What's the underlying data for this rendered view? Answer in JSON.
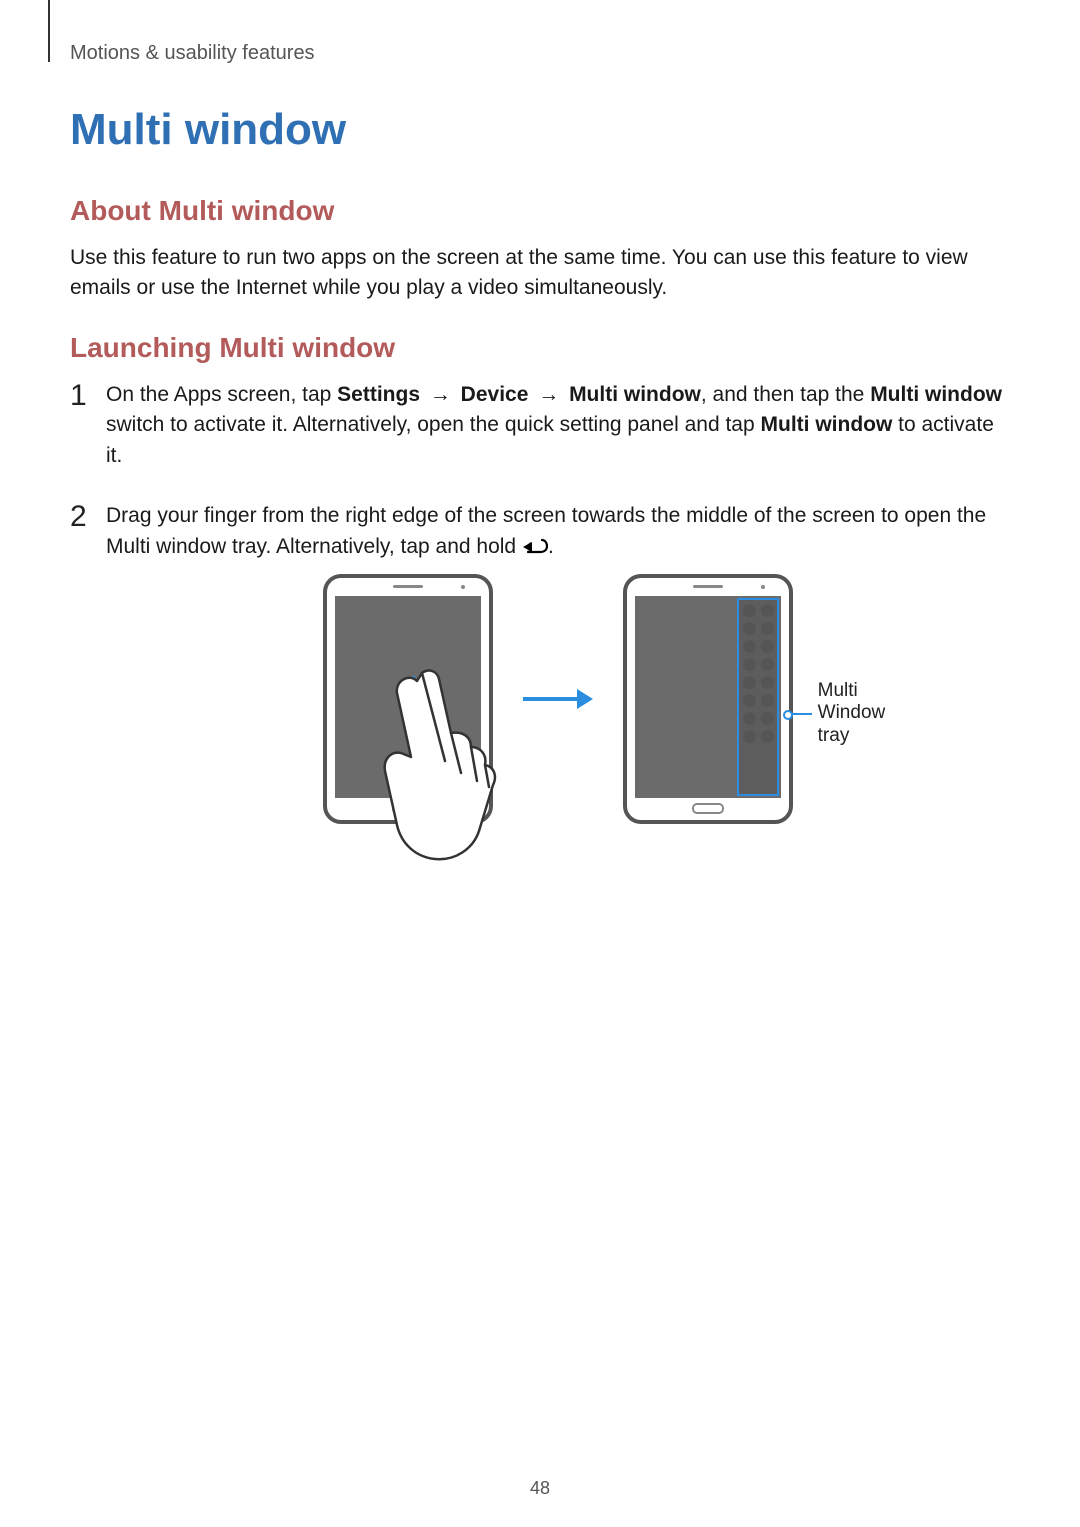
{
  "header": {
    "running_head": "Motions & usability features"
  },
  "title": "Multi window",
  "section_about": {
    "heading": "About Multi window",
    "body": "Use this feature to run two apps on the screen at the same time. You can use this feature to view emails or use the Internet while you play a video simultaneously."
  },
  "section_launch": {
    "heading": "Launching Multi window",
    "step1": {
      "num": "1",
      "pre": "On the Apps screen, tap ",
      "path_settings": "Settings",
      "sep": " → ",
      "path_device": "Device",
      "path_multi": "Multi window",
      "mid1": ", and then tap the ",
      "bold_switch": "Multi window",
      "mid2": " switch to activate it. Alternatively, open the quick setting panel and tap ",
      "bold_panel": "Multi window",
      "tail": " to activate it."
    },
    "step2": {
      "num": "2",
      "text_a": "Drag your finger from the right edge of the screen towards the middle of the screen to open the Multi window tray. Alternatively, tap and hold ",
      "text_b": "."
    }
  },
  "figure": {
    "callout_label": "Multi Window tray"
  },
  "page_number": "48"
}
